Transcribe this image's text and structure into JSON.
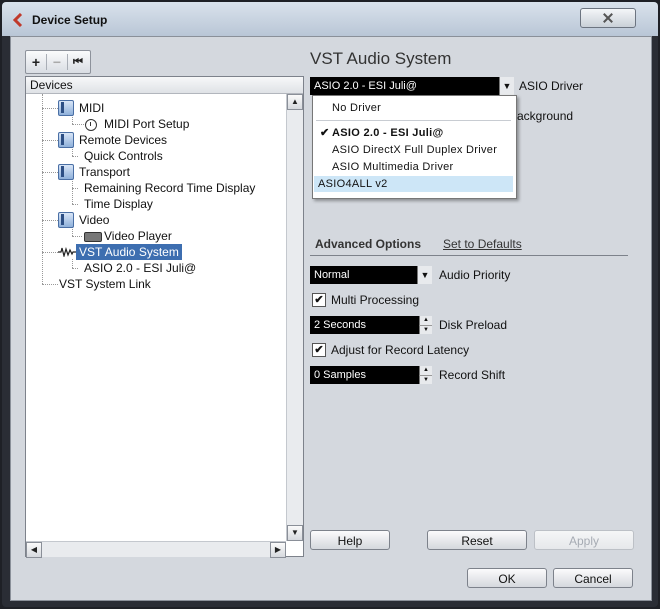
{
  "window": {
    "title": "Device Setup"
  },
  "toolbar": {
    "add": "+",
    "remove": "−",
    "reset": "⏮"
  },
  "tree": {
    "header": "Devices",
    "nodes": [
      {
        "label": "MIDI"
      },
      {
        "label": "MIDI Port Setup"
      },
      {
        "label": "Remote Devices"
      },
      {
        "label": "Quick Controls"
      },
      {
        "label": "Transport"
      },
      {
        "label": "Remaining Record Time Display"
      },
      {
        "label": "Time Display"
      },
      {
        "label": "Video"
      },
      {
        "label": "Video Player"
      },
      {
        "label": "VST Audio System"
      },
      {
        "label": "ASIO 2.0 - ESI Juli@"
      },
      {
        "label": "VST System Link"
      }
    ],
    "selected": "VST Audio System"
  },
  "panel": {
    "title": "VST Audio System",
    "asio_driver": {
      "value": "ASIO 2.0 - ESI Juli@",
      "label": "ASIO Driver"
    },
    "background_partial": "ackground",
    "dropdown": {
      "items": [
        "No Driver",
        "ASIO 2.0 - ESI Juli@",
        "ASIO DirectX Full Duplex Driver",
        "ASIO Multimedia Driver",
        "ASIO4ALL v2"
      ],
      "checked": "ASIO 2.0 - ESI Juli@",
      "highlighted": "ASIO4ALL v2"
    },
    "advanced": {
      "title": "Advanced Options",
      "set_defaults": "Set to Defaults",
      "audio_priority": {
        "value": "Normal",
        "label": "Audio Priority"
      },
      "multi_processing": {
        "label": "Multi Processing",
        "checked": true
      },
      "disk_preload": {
        "value": "2 Seconds",
        "label": "Disk Preload"
      },
      "record_latency": {
        "label": "Adjust for Record Latency",
        "checked": true
      },
      "record_shift": {
        "value": "0 Samples",
        "label": "Record Shift"
      }
    }
  },
  "buttons": {
    "help": "Help",
    "reset": "Reset",
    "apply": "Apply",
    "ok": "OK",
    "cancel": "Cancel"
  }
}
